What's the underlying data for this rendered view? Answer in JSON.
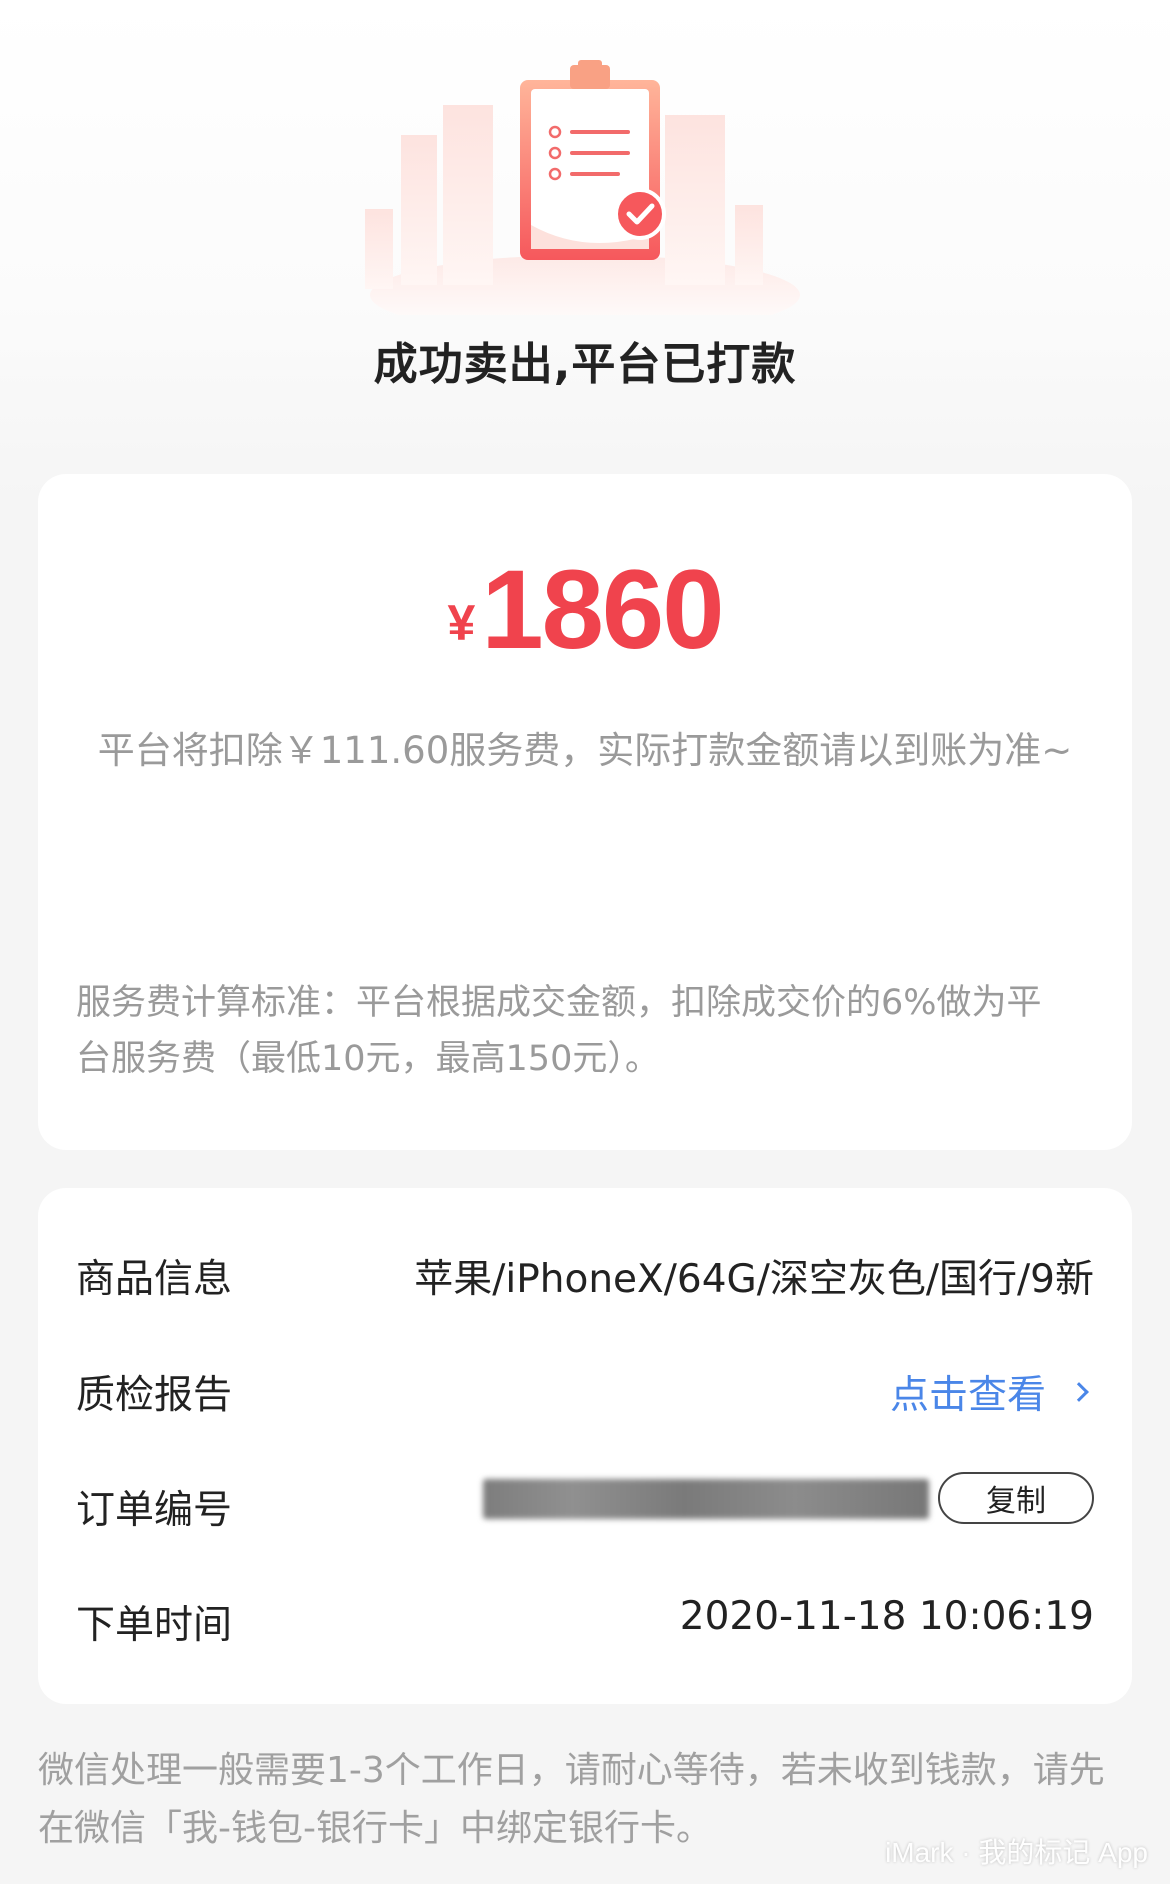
{
  "header": {
    "title": "成功卖出,平台已打款"
  },
  "amount_card": {
    "currency": "¥",
    "amount": "1860",
    "fee_note": "平台将扣除￥111.60服务费，实际打款金额请以到账为准~",
    "fee_rule": "服务费计算标准：平台根据成交金额，扣除成交价的6%做为平台服务费（最低10元，最高150元）。"
  },
  "info_card": {
    "rows": [
      {
        "label": "商品信息",
        "value": "苹果/iPhoneX/64G/深空灰色/国行/9新"
      },
      {
        "label": "质检报告",
        "value": "点击查看"
      },
      {
        "label": "订单编号",
        "value": ""
      },
      {
        "label": "下单时间",
        "value": "2020-11-18 10:06:19"
      }
    ],
    "copy_label": "复制"
  },
  "footer": {
    "note": "微信处理一般需要1-3个工作日，请耐心等待，若未收到钱款，请先在微信「我-钱包-银行卡」中绑定银行卡。"
  },
  "watermark": "iMark · 我的标记 App",
  "colors": {
    "accent_red": "#f0434d",
    "link_blue": "#4a86e8",
    "muted_text": "#9a9a9a",
    "background": "#f5f5f5"
  },
  "icons": {
    "illustration": "clipboard-check-illustration",
    "link_arrow": "chevron-right-icon"
  }
}
